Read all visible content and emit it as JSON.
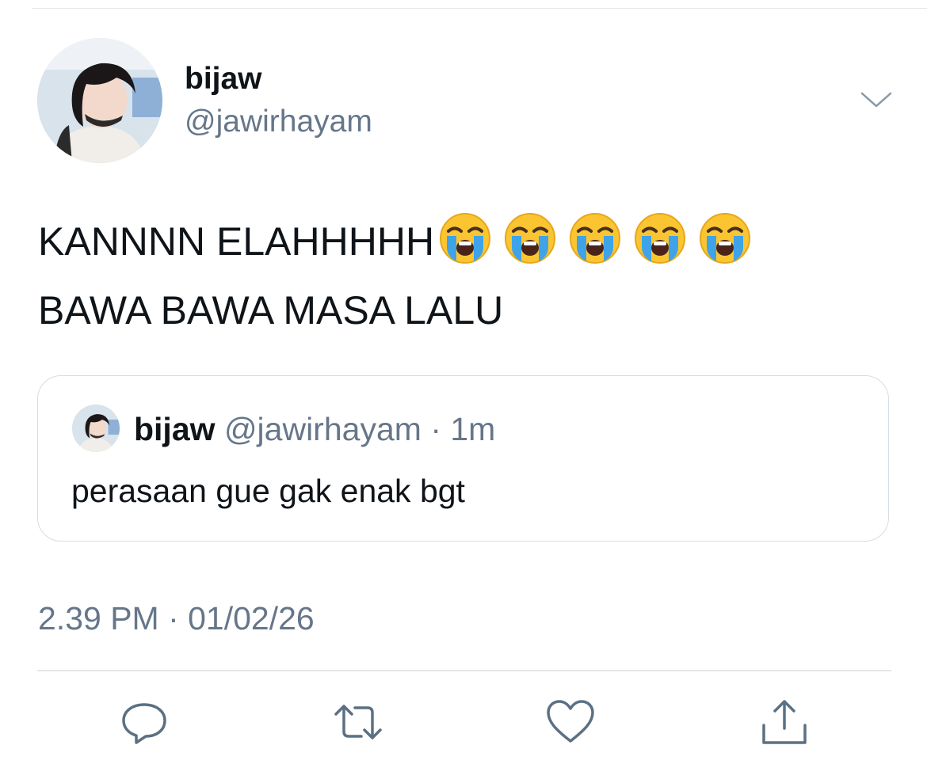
{
  "tweet": {
    "author_name": "bijaw",
    "author_handle": "@jawirhayam",
    "text_line1": "KANNNN ELAHHHHH",
    "text_line2": "BAWA BAWA MASA LALU",
    "emoji": "loudly-crying-face",
    "emoji_count": 5,
    "timestamp": "2.39 PM · 01/02/26"
  },
  "quoted_tweet": {
    "author_name": "bijaw",
    "author_handle": "@jawirhayam",
    "separator": "·",
    "relative_time": "1m",
    "text": "perasaan gue gak enak bgt"
  },
  "icons": {
    "more": "chevron-down-icon",
    "reply": "reply-icon",
    "retweet": "retweet-icon",
    "like": "heart-icon",
    "share": "share-icon"
  },
  "colors": {
    "text": "#0f1419",
    "secondary_text": "#66768a",
    "border": "#d6dde3",
    "icon": "#5b7083"
  }
}
